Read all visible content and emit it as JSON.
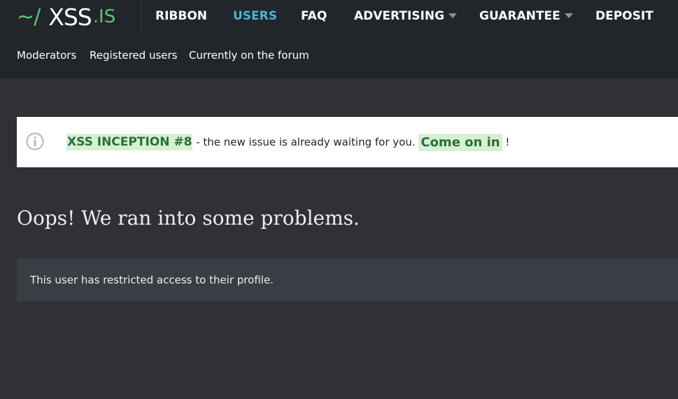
{
  "logo": {
    "tilde": "~/",
    "name": "XSS",
    "tld": ".IS"
  },
  "nav": {
    "ribbon": "RIBBON",
    "users": "USERS",
    "faq": "FAQ",
    "advertising": "ADVERTISING",
    "guarantee": "GUARANTEE",
    "deposit": "DEPOSIT"
  },
  "subnav": {
    "moderators": "Moderators",
    "registered": "Registered users",
    "online": "Currently on the forum"
  },
  "notice": {
    "title": "XSS INCEPTION #8",
    "message": " - the new issue is already waiting for you. ",
    "link": "Come on in",
    "suffix": " !"
  },
  "page": {
    "title": "Oops! We ran into some problems.",
    "error": "This user has restricted access to their profile."
  },
  "colors": {
    "accent_green": "#5ec27a",
    "active_nav": "#47b8d6",
    "highlight_bg": "#d6f0d2"
  },
  "icons": {
    "notice": "info-circle-icon",
    "dropdown": "caret-down-icon"
  }
}
